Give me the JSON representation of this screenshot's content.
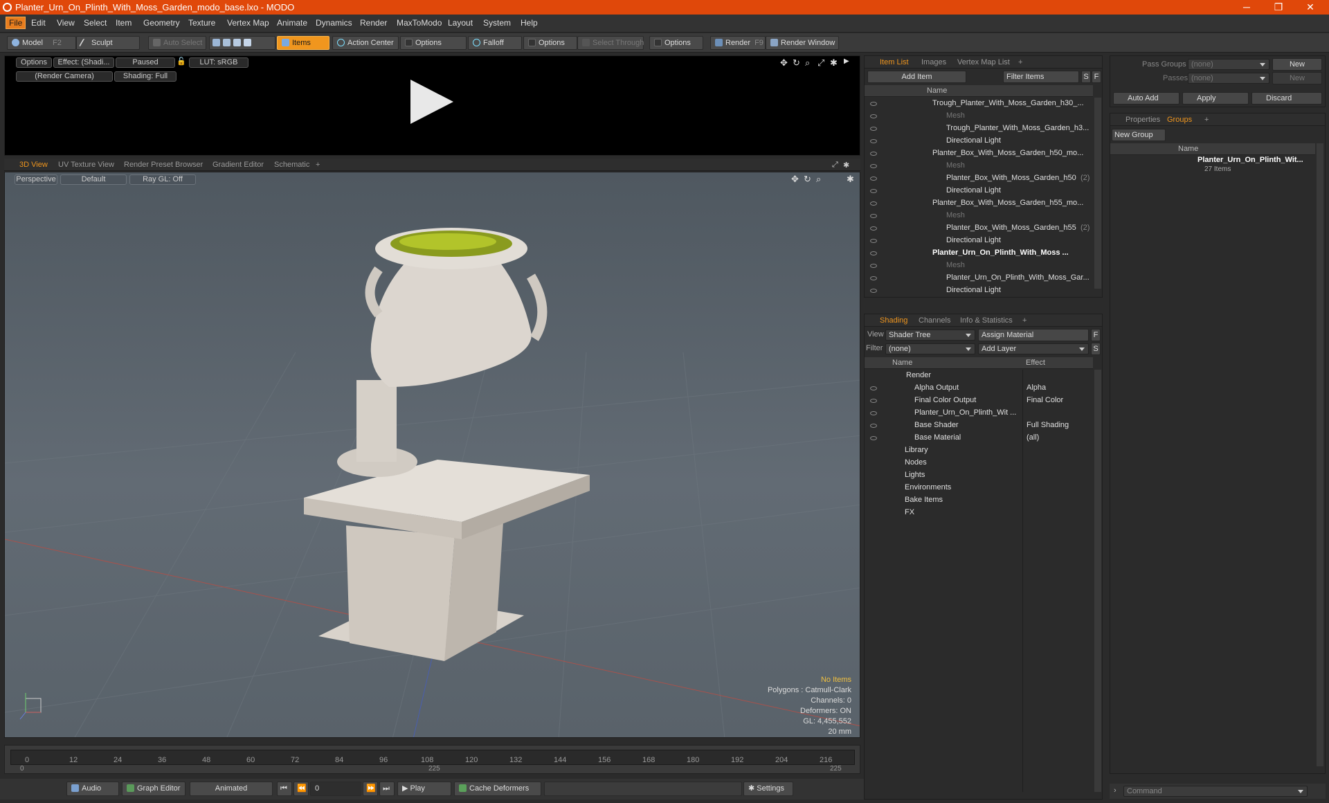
{
  "window": {
    "title": "Planter_Urn_On_Plinth_With_Moss_Garden_modo_base.lxo - MODO",
    "minimize": "─",
    "restore": "❐",
    "close": "✕"
  },
  "menu": [
    "File",
    "Edit",
    "View",
    "Select",
    "Item",
    "Geometry",
    "Texture",
    "Vertex Map",
    "Animate",
    "Dynamics",
    "Render",
    "MaxToModo",
    "Layout",
    "System",
    "Help"
  ],
  "toolbar": {
    "model": "Model",
    "model_key": "F2",
    "sculpt": "Sculpt",
    "auto_select": "Auto Select",
    "items": "Items",
    "action_center": "Action Center",
    "options1": "Options",
    "falloff": "Falloff",
    "options2": "Options",
    "select_through": "Select Through",
    "options3": "Options",
    "render": "Render",
    "render_key": "F9",
    "render_window": "Render Window"
  },
  "preview": {
    "options": "Options",
    "effect": "Effect: (Shadi...",
    "paused": "Paused",
    "lut": "LUT: sRGB",
    "camera": "(Render Camera)",
    "shading": "Shading: Full"
  },
  "viewport_tabs": [
    "3D View",
    "UV Texture View",
    "Render Preset Browser",
    "Gradient Editor",
    "Schematic",
    "+"
  ],
  "viewport": {
    "perspective": "Perspective",
    "default": "Default",
    "raygl": "Ray GL: Off",
    "info": [
      "No Items",
      "Polygons : Catmull-Clark",
      "Channels: 0",
      "Deformers: ON",
      "GL: 4,455,552",
      "20 mm"
    ]
  },
  "timeline": {
    "ticks": [
      "0",
      "12",
      "24",
      "36",
      "48",
      "60",
      "72",
      "84",
      "96",
      "108",
      "120",
      "132",
      "144",
      "156",
      "168",
      "180",
      "192",
      "204",
      "216"
    ],
    "start": "0",
    "mid": "225",
    "end": "225"
  },
  "bottom": {
    "audio": "Audio",
    "graph_editor": "Graph Editor",
    "animated": "Animated",
    "frame": "0",
    "play": "Play",
    "cache": "Cache Deformers",
    "settings": "Settings"
  },
  "item_list": {
    "tabs": [
      "Item List",
      "Images",
      "Vertex Map List",
      "+"
    ],
    "add_item": "Add Item",
    "filter": "Filter Items",
    "s": "S",
    "f": "F",
    "col_name": "Name",
    "rows": [
      {
        "label": "Trough_Planter_With_Moss_Garden_h30_...",
        "style": ""
      },
      {
        "label": "Mesh",
        "style": "dim"
      },
      {
        "label": "Trough_Planter_With_Moss_Garden_h3...",
        "style": ""
      },
      {
        "label": "Directional Light",
        "style": ""
      },
      {
        "label": "Planter_Box_With_Moss_Garden_h50_mo...",
        "style": ""
      },
      {
        "label": "Mesh",
        "style": "dim"
      },
      {
        "label": "Planter_Box_With_Moss_Garden_h50",
        "style": "",
        "count": "(2)"
      },
      {
        "label": "Directional Light",
        "style": ""
      },
      {
        "label": "Planter_Box_With_Moss_Garden_h55_mo...",
        "style": ""
      },
      {
        "label": "Mesh",
        "style": "dim"
      },
      {
        "label": "Planter_Box_With_Moss_Garden_h55",
        "style": "",
        "count": "(2)"
      },
      {
        "label": "Directional Light",
        "style": ""
      },
      {
        "label": "Planter_Urn_On_Plinth_With_Moss ...",
        "style": "bold"
      },
      {
        "label": "Mesh",
        "style": "dim"
      },
      {
        "label": "Planter_Urn_On_Plinth_With_Moss_Gar...",
        "style": ""
      },
      {
        "label": "Directional Light",
        "style": ""
      }
    ]
  },
  "shading": {
    "tabs": [
      "Shading",
      "Channels",
      "Info & Statistics",
      "+"
    ],
    "view_label": "View",
    "view": "Shader Tree",
    "assign": "Assign Material",
    "f": "F",
    "filter_label": "Filter",
    "filter": "(none)",
    "add_layer": "Add Layer",
    "s": "S",
    "col_name": "Name",
    "col_effect": "Effect",
    "rows": [
      {
        "label": "Render",
        "effect": ""
      },
      {
        "label": "Alpha Output",
        "effect": "Alpha"
      },
      {
        "label": "Final Color Output",
        "effect": "Final Color"
      },
      {
        "label": "Planter_Urn_On_Plinth_Wit ...",
        "effect": ""
      },
      {
        "label": "Base Shader",
        "effect": "Full Shading"
      },
      {
        "label": "Base Material",
        "effect": "(all)"
      },
      {
        "label": "Library",
        "effect": ""
      },
      {
        "label": "Nodes",
        "effect": ""
      },
      {
        "label": "Lights",
        "effect": ""
      },
      {
        "label": "Environments",
        "effect": ""
      },
      {
        "label": "Bake Items",
        "effect": ""
      },
      {
        "label": "FX",
        "effect": ""
      }
    ]
  },
  "right": {
    "pass_groups": "Pass Groups",
    "pass_groups_val": "(none)",
    "new1": "New",
    "passes": "Passes",
    "passes_val": "(none)",
    "new2": "New",
    "auto_add": "Auto Add",
    "apply": "Apply",
    "discard": "Discard",
    "tabs": [
      "Properties",
      "Groups",
      "+"
    ],
    "new_group": "New Group",
    "col_name": "Name",
    "group_name": "Planter_Urn_On_Plinth_Wit...",
    "group_count": "27 Items",
    "command": "Command"
  }
}
